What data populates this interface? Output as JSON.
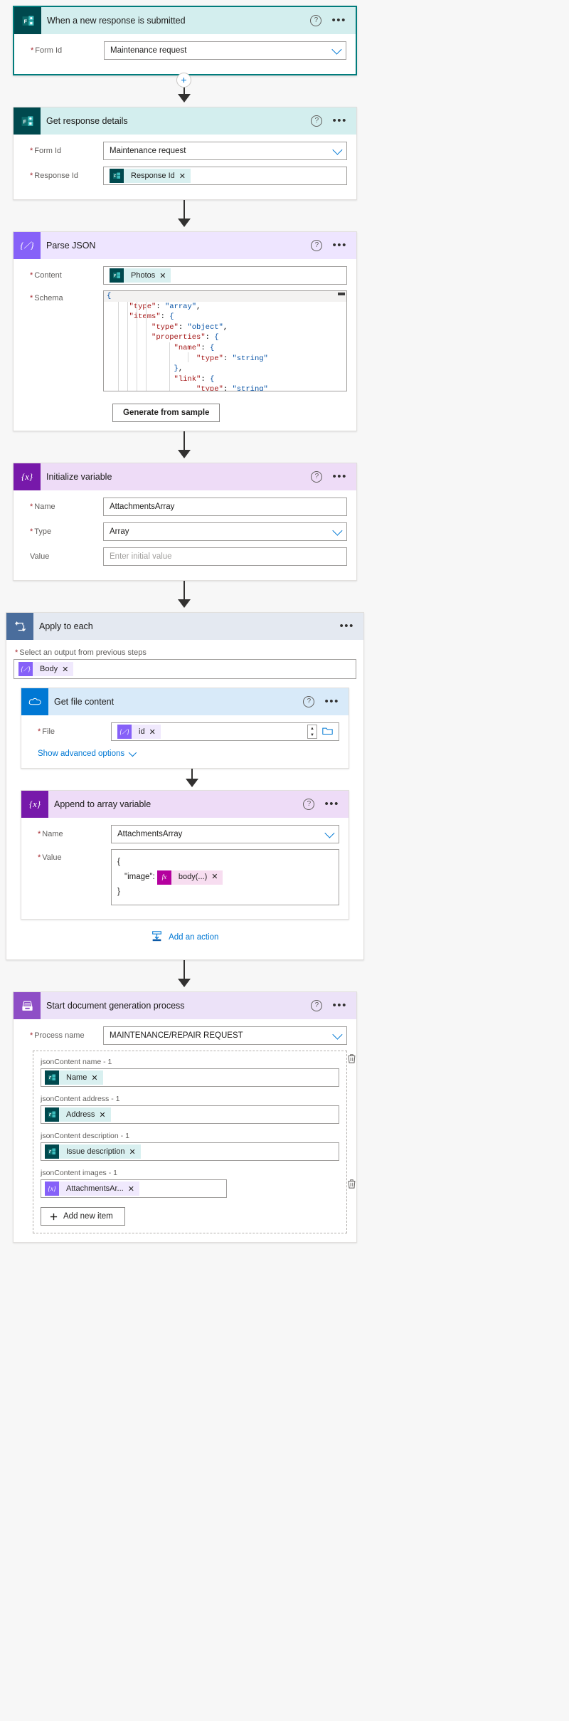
{
  "flow": {
    "steps": [
      {
        "id": "trigger",
        "title": "When a new response is submitted",
        "icon": "microsoft-forms-icon",
        "fields": [
          {
            "label": "Form Id",
            "required": true,
            "value": "Maintenance request",
            "type": "dropdown"
          }
        ]
      },
      {
        "id": "get-response-details",
        "title": "Get response details",
        "icon": "microsoft-forms-icon",
        "fields": [
          {
            "label": "Form Id",
            "required": true,
            "value": "Maintenance request",
            "type": "dropdown"
          },
          {
            "label": "Response Id",
            "required": true,
            "token": "Response Id",
            "type": "token"
          }
        ]
      },
      {
        "id": "parse-json",
        "title": "Parse JSON",
        "icon": "parse-json-icon",
        "fields": [
          {
            "label": "Content",
            "required": true,
            "token": "Photos",
            "type": "token"
          },
          {
            "label": "Schema",
            "required": true,
            "type": "code"
          }
        ],
        "schema_lines": [
          "{",
          "     \"type\": \"array\",",
          "     \"items\": {",
          "          \"type\": \"object\",",
          "          \"properties\": {",
          "               \"name\": {",
          "                    \"type\": \"string\"",
          "               },",
          "               \"link\": {",
          "                    \"type\": \"string\""
        ],
        "generate_button": "Generate from sample"
      },
      {
        "id": "initialize-variable",
        "title": "Initialize variable",
        "icon": "variable-icon",
        "fields": [
          {
            "label": "Name",
            "required": true,
            "value": "AttachmentsArray",
            "type": "text"
          },
          {
            "label": "Type",
            "required": true,
            "value": "Array",
            "type": "dropdown"
          },
          {
            "label": "Value",
            "required": false,
            "placeholder": "Enter initial value",
            "type": "text"
          }
        ]
      }
    ],
    "loop": {
      "title": "Apply to each",
      "icon": "loop-icon",
      "select_label": "Select an output from previous steps",
      "select_required": true,
      "select_token": "Body",
      "add_action_label": "Add an action",
      "children": [
        {
          "id": "get-file-content",
          "title": "Get file content",
          "icon": "onedrive-icon",
          "fields": [
            {
              "label": "File",
              "required": true,
              "token": "id",
              "type": "token-file"
            }
          ],
          "advanced_link": "Show advanced options"
        },
        {
          "id": "append-to-array-variable",
          "title": "Append to array variable",
          "icon": "variable-icon",
          "fields": [
            {
              "label": "Name",
              "required": true,
              "value": "AttachmentsArray",
              "type": "dropdown"
            },
            {
              "label": "Value",
              "required": true,
              "type": "value-json"
            }
          ],
          "value_lines": {
            "open": "{",
            "key": "\"image\":",
            "token": "body(...)",
            "close": "}"
          }
        }
      ]
    },
    "final": {
      "id": "start-document-generation-process",
      "title": "Start document generation process",
      "icon": "document-generation-icon",
      "fields": [
        {
          "label": "Process name",
          "required": true,
          "value": "MAINTENANCE/REPAIR REQUEST",
          "type": "dropdown"
        }
      ],
      "items": [
        {
          "label": "jsonContent name - 1",
          "token": "Name",
          "token_kind": "forms",
          "side_icon": "delete-icon"
        },
        {
          "label": "jsonContent address - 1",
          "token": "Address",
          "token_kind": "forms",
          "side_icon": ""
        },
        {
          "label": "jsonContent description - 1",
          "token": "Issue description",
          "token_kind": "forms",
          "side_icon": ""
        },
        {
          "label": "jsonContent images - 1",
          "token": "AttachmentsAr...",
          "token_kind": "variable",
          "side_icon": "delete-icon"
        }
      ],
      "add_item_label": "Add new item"
    },
    "common": {
      "help_glyph": "?",
      "ellipsis_glyph": "•••",
      "plus_glyph": "+",
      "close_glyph": "✕"
    }
  }
}
